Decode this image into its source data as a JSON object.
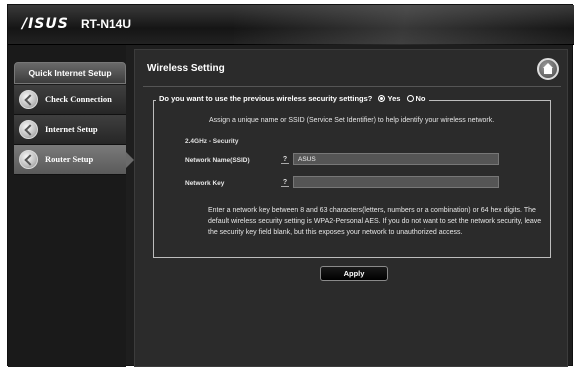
{
  "header": {
    "brand": "/ISUS",
    "model": "RT-N14U"
  },
  "sidebar": {
    "title": "Quick Internet Setup",
    "items": [
      {
        "label": "Check Connection",
        "active": false
      },
      {
        "label": "Internet Setup",
        "active": false
      },
      {
        "label": "Router Setup",
        "active": true
      }
    ]
  },
  "main": {
    "title": "Wireless Setting",
    "question": "Do you want to use the previous wireless security settings?",
    "options": [
      {
        "label": "Yes",
        "selected": true
      },
      {
        "label": "No",
        "selected": false
      }
    ],
    "instruction": "Assign a unique name or SSID (Service Set Identifier) to help identify your wireless network.",
    "section_label": "2.4GHz - Security",
    "fields": {
      "ssid": {
        "label": "Network Name(SSID)",
        "value": "ASUS",
        "help": "?"
      },
      "key": {
        "label": "Network Key",
        "value": "",
        "help": "?"
      }
    },
    "description": "Enter a network key between 8 and 63 characters(letters, numbers or a combination) or 64 hex digits. The default wireless security setting is WPA2-Personal AES. If you do not want to set the network security, leave the security key field blank, but this exposes your network to unauthorized access.",
    "apply_label": "Apply"
  }
}
